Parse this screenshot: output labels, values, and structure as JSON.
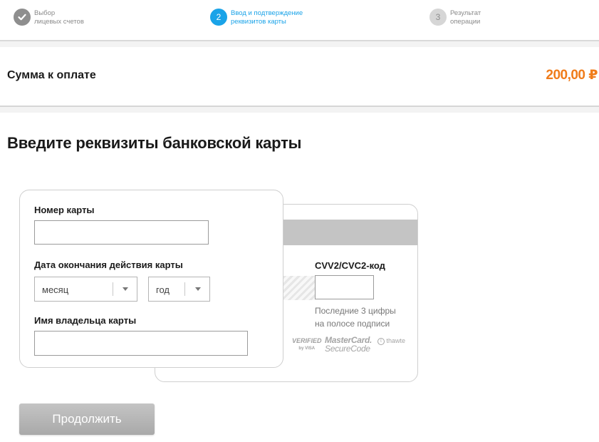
{
  "stepper": {
    "steps": [
      {
        "number": "",
        "icon": "checkmark-icon",
        "line1": "Выбор",
        "line2": "лицевых счетов",
        "state": "done"
      },
      {
        "number": "2",
        "line1": "Ввод и подтверждение",
        "line2": "реквизитов карты",
        "state": "active"
      },
      {
        "number": "3",
        "line1": "Результат",
        "line2": "операции",
        "state": "todo"
      }
    ]
  },
  "summary": {
    "label": "Сумма к оплате",
    "amount": "200,00 ₽"
  },
  "heading": "Введите реквизиты банковской карты",
  "card_front": {
    "card_number_label": "Номер карты",
    "card_number_value": "",
    "expiry_label": "Дата окончания действия карты",
    "month_value": "месяц",
    "year_value": "год",
    "holder_label": "Имя владельца карты",
    "holder_value": ""
  },
  "card_back": {
    "cvv_label": "CVV2/CVC2-код",
    "cvv_value": "",
    "cvv_hint_line1": "Последние 3 цифры",
    "cvv_hint_line2": "на полосе подписи",
    "logos": {
      "verified_line1": "VERIFIED",
      "verified_line2": "by VISA",
      "mc_line1": "MasterCard.",
      "mc_line2": "SecureCode",
      "thawte_name": "thawte",
      "thawte_tagline": ""
    }
  },
  "continue_label": "Продолжить",
  "colors": {
    "accent": "#1aa3e8",
    "amount": "#f07c1a",
    "button": "#b5b5b5"
  }
}
